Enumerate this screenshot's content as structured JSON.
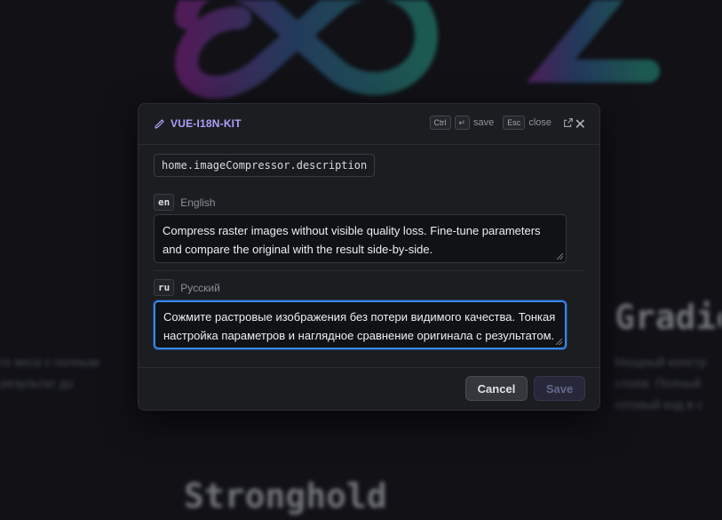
{
  "background": {
    "left_text": [
      "го веса с полным",
      "результат до"
    ],
    "right_title": "Gradie",
    "right_text": [
      "Мощный констр",
      "слоёв. Полный",
      "готовый код в с"
    ],
    "bottom_title": "Stronghold"
  },
  "modal": {
    "title": "VUE-I18N-KIT",
    "hotkeys": {
      "ctrl": "Ctrl",
      "enter": "↵",
      "save_label": "save",
      "esc": "Esc",
      "close_label": "close"
    },
    "key": "home.imageCompressor.description",
    "locales": [
      {
        "code": "en",
        "name": "English",
        "value": "Compress raster images without visible quality loss. Fine-tune parameters and compare the original with the result side-by-side."
      },
      {
        "code": "ru",
        "name": "Русский",
        "value": "Сожмите растровые изображения без потери видимого качества. Тонкая настройка параметров и наглядное сравнение оригинала с результатом."
      }
    ],
    "cancel_label": "Cancel",
    "save_label": "Save"
  },
  "colors": {
    "accent": "#a9a2f8",
    "focus": "#3a85e6",
    "bg": "#16171d"
  }
}
